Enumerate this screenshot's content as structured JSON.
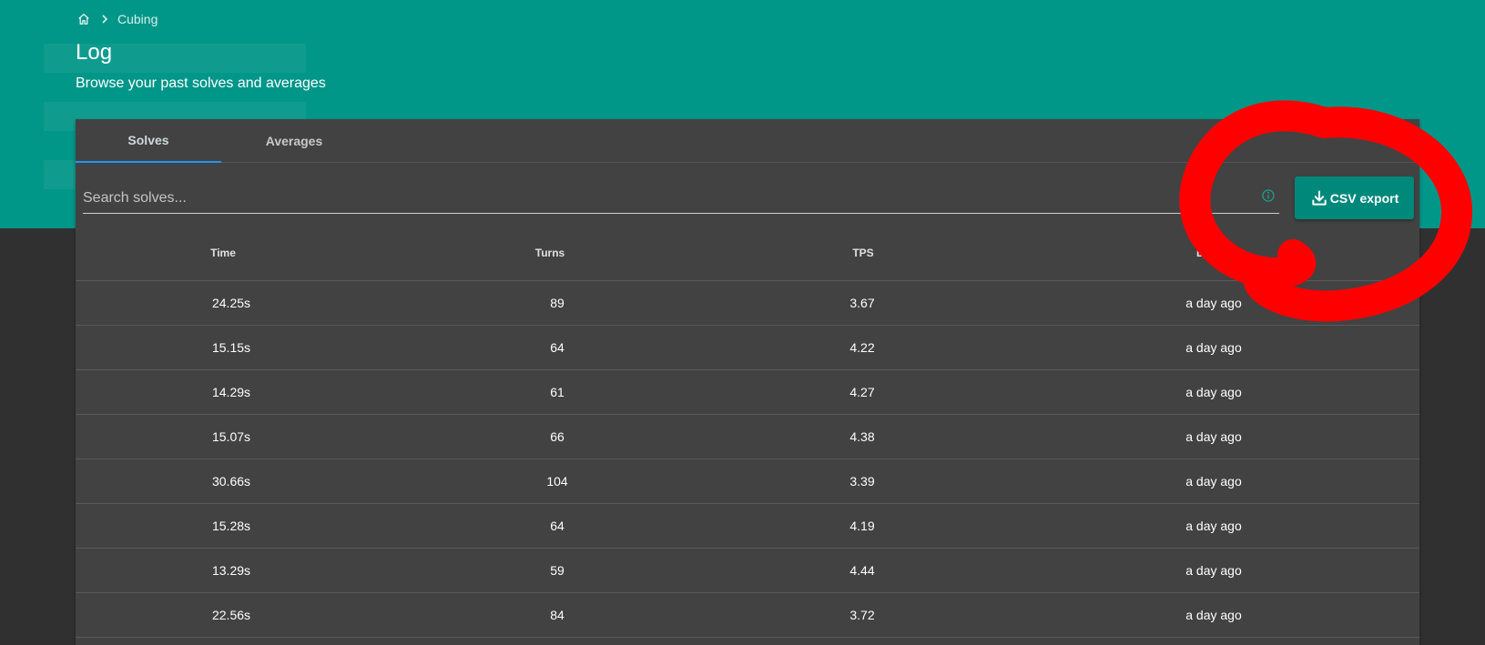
{
  "breadcrumb": {
    "home_icon": "home-icon",
    "separator_icon": "chevron-right-icon",
    "current": "Cubing"
  },
  "header": {
    "title": "Log",
    "subtitle": "Browse your past solves and averages"
  },
  "tabs": [
    {
      "label": "Solves",
      "active": true
    },
    {
      "label": "Averages",
      "active": false
    }
  ],
  "search": {
    "placeholder": "Search solves...",
    "value": "",
    "info_icon": "info-icon"
  },
  "csv_button": {
    "label": "CSV export",
    "icon": "download-icon"
  },
  "table": {
    "columns": [
      "Time",
      "Turns",
      "TPS",
      "Date"
    ],
    "rows": [
      [
        "24.25s",
        "89",
        "3.67",
        "a day ago"
      ],
      [
        "15.15s",
        "64",
        "4.22",
        "a day ago"
      ],
      [
        "14.29s",
        "61",
        "4.27",
        "a day ago"
      ],
      [
        "15.07s",
        "66",
        "4.38",
        "a day ago"
      ],
      [
        "30.66s",
        "104",
        "3.39",
        "a day ago"
      ],
      [
        "15.28s",
        "64",
        "4.19",
        "a day ago"
      ],
      [
        "13.29s",
        "59",
        "4.44",
        "a day ago"
      ],
      [
        "22.56s",
        "84",
        "3.72",
        "a day ago"
      ]
    ]
  },
  "colors": {
    "header_bg": "#009688",
    "page_bg": "#303030",
    "card_bg": "#424242",
    "accent": "#00897b",
    "tab_indicator": "#2196f3",
    "annotation": "#ff0000"
  }
}
